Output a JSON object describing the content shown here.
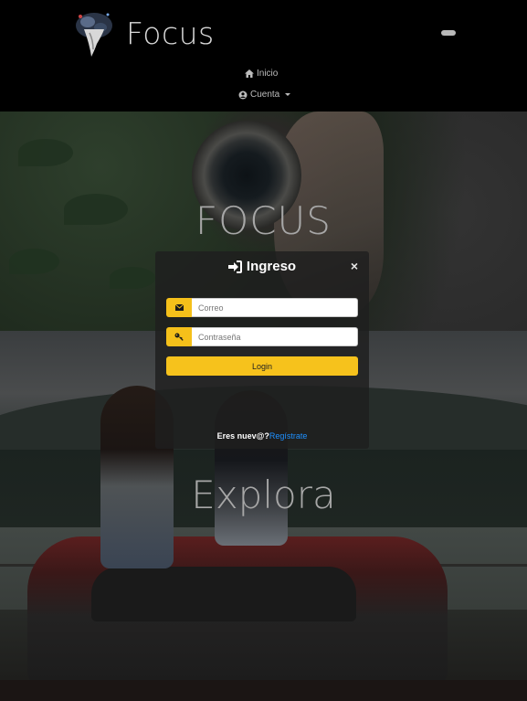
{
  "navbar": {
    "brand": "Focus",
    "links": {
      "inicio": "Inicio",
      "cuenta": "Cuenta"
    }
  },
  "hero": {
    "section1_title": "FOCUS",
    "section2_title": "Explora"
  },
  "login_modal": {
    "title": "Ingreso",
    "close": "×",
    "email_placeholder": "Correo",
    "password_placeholder": "Contraseña",
    "login_label": "Login",
    "register_question": "Eres nuev@?",
    "register_link": "Regístrate"
  },
  "colors": {
    "accent": "#f6c21c",
    "link": "#1e90ff",
    "navbar_bg": "#000000"
  },
  "icons": {
    "brand": "logo-icon",
    "toggler": "menu-toggler-icon",
    "inicio": "home-icon",
    "cuenta": "user-circle-icon",
    "title": "sign-in-icon",
    "email": "envelope-icon",
    "password": "key-icon"
  }
}
